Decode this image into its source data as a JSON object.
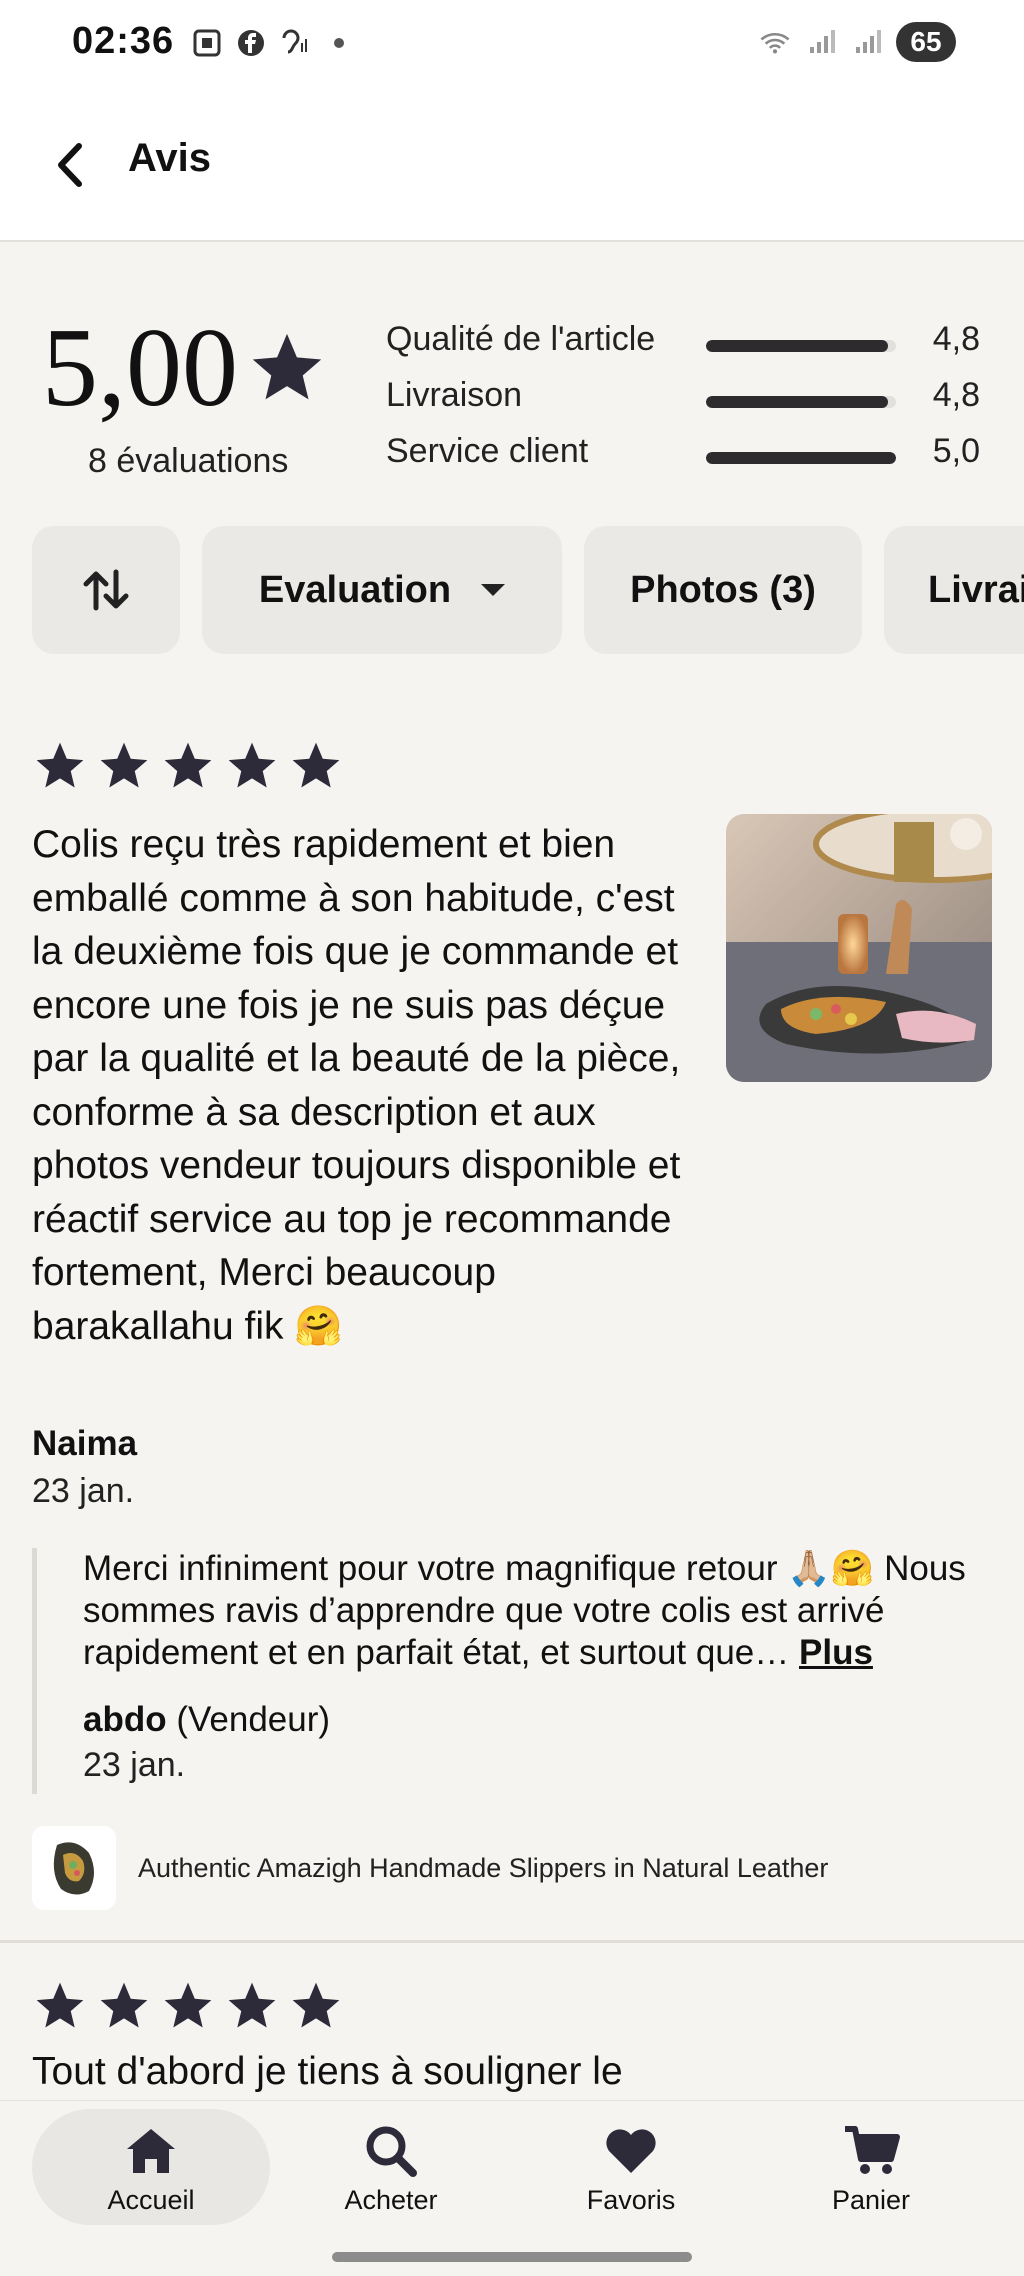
{
  "status_bar": {
    "time": "02:36",
    "battery": "65",
    "icons": [
      "screenshot-icon",
      "facebook-icon",
      "hearing-icon",
      "dot-icon",
      "wifi-icon",
      "signal-icon",
      "signal-icon"
    ]
  },
  "header": {
    "back_icon": "chevron-left-icon",
    "title": "Avis"
  },
  "summary": {
    "rating": "5,00",
    "count_label": "8 évaluations",
    "metrics": [
      {
        "label": "Qualité de l'article",
        "value": "4,8",
        "fraction": 0.96
      },
      {
        "label": "Livraison",
        "value": "4,8",
        "fraction": 0.96
      },
      {
        "label": "Service client",
        "value": "5,0",
        "fraction": 1.0
      }
    ]
  },
  "filters": {
    "sort_icon": "sort-arrows-icon",
    "evaluation": "Evaluation",
    "photos": "Photos (3)",
    "livraison_partial": "Livrai"
  },
  "reviews": [
    {
      "stars": 5,
      "text": "Colis reçu très rapidement et bien  emballé comme à son habitude, c'est la deuxième fois que je commande et encore une fois je ne suis pas déçue par la qualité et la beauté de la pièce, conforme à sa description et aux photos vendeur toujours disponible et réactif service au top je recommande fortement, Merci beaucoup barakallahu fik 🤗",
      "author": "Naima",
      "date": "23 jan.",
      "reply": {
        "text": "Merci infiniment pour votre magnifique retour 🙏🏼🤗 Nous sommes ravis d’apprendre que votre colis est arrivé rapidement et en parfait état, et surtout que…",
        "more": "Plus",
        "author": "abdo",
        "role": "(Vendeur)",
        "date": "23 jan."
      },
      "listing": "Authentic Amazigh Handmade Slippers in Natural Leather"
    },
    {
      "stars": 5,
      "text": "Tout d'abord je tiens à souligner le"
    }
  ],
  "bottom_nav": [
    {
      "label": "Accueil",
      "icon": "home-icon",
      "active": true
    },
    {
      "label": "Acheter",
      "icon": "search-icon",
      "active": false
    },
    {
      "label": "Favoris",
      "icon": "heart-icon",
      "active": false
    },
    {
      "label": "Panier",
      "icon": "cart-icon",
      "active": false
    }
  ],
  "colors": {
    "background": "#f5f4f1",
    "chip": "#ebe9e5",
    "star": "#2d2b3a",
    "bar_fill": "#2d2b2d"
  }
}
